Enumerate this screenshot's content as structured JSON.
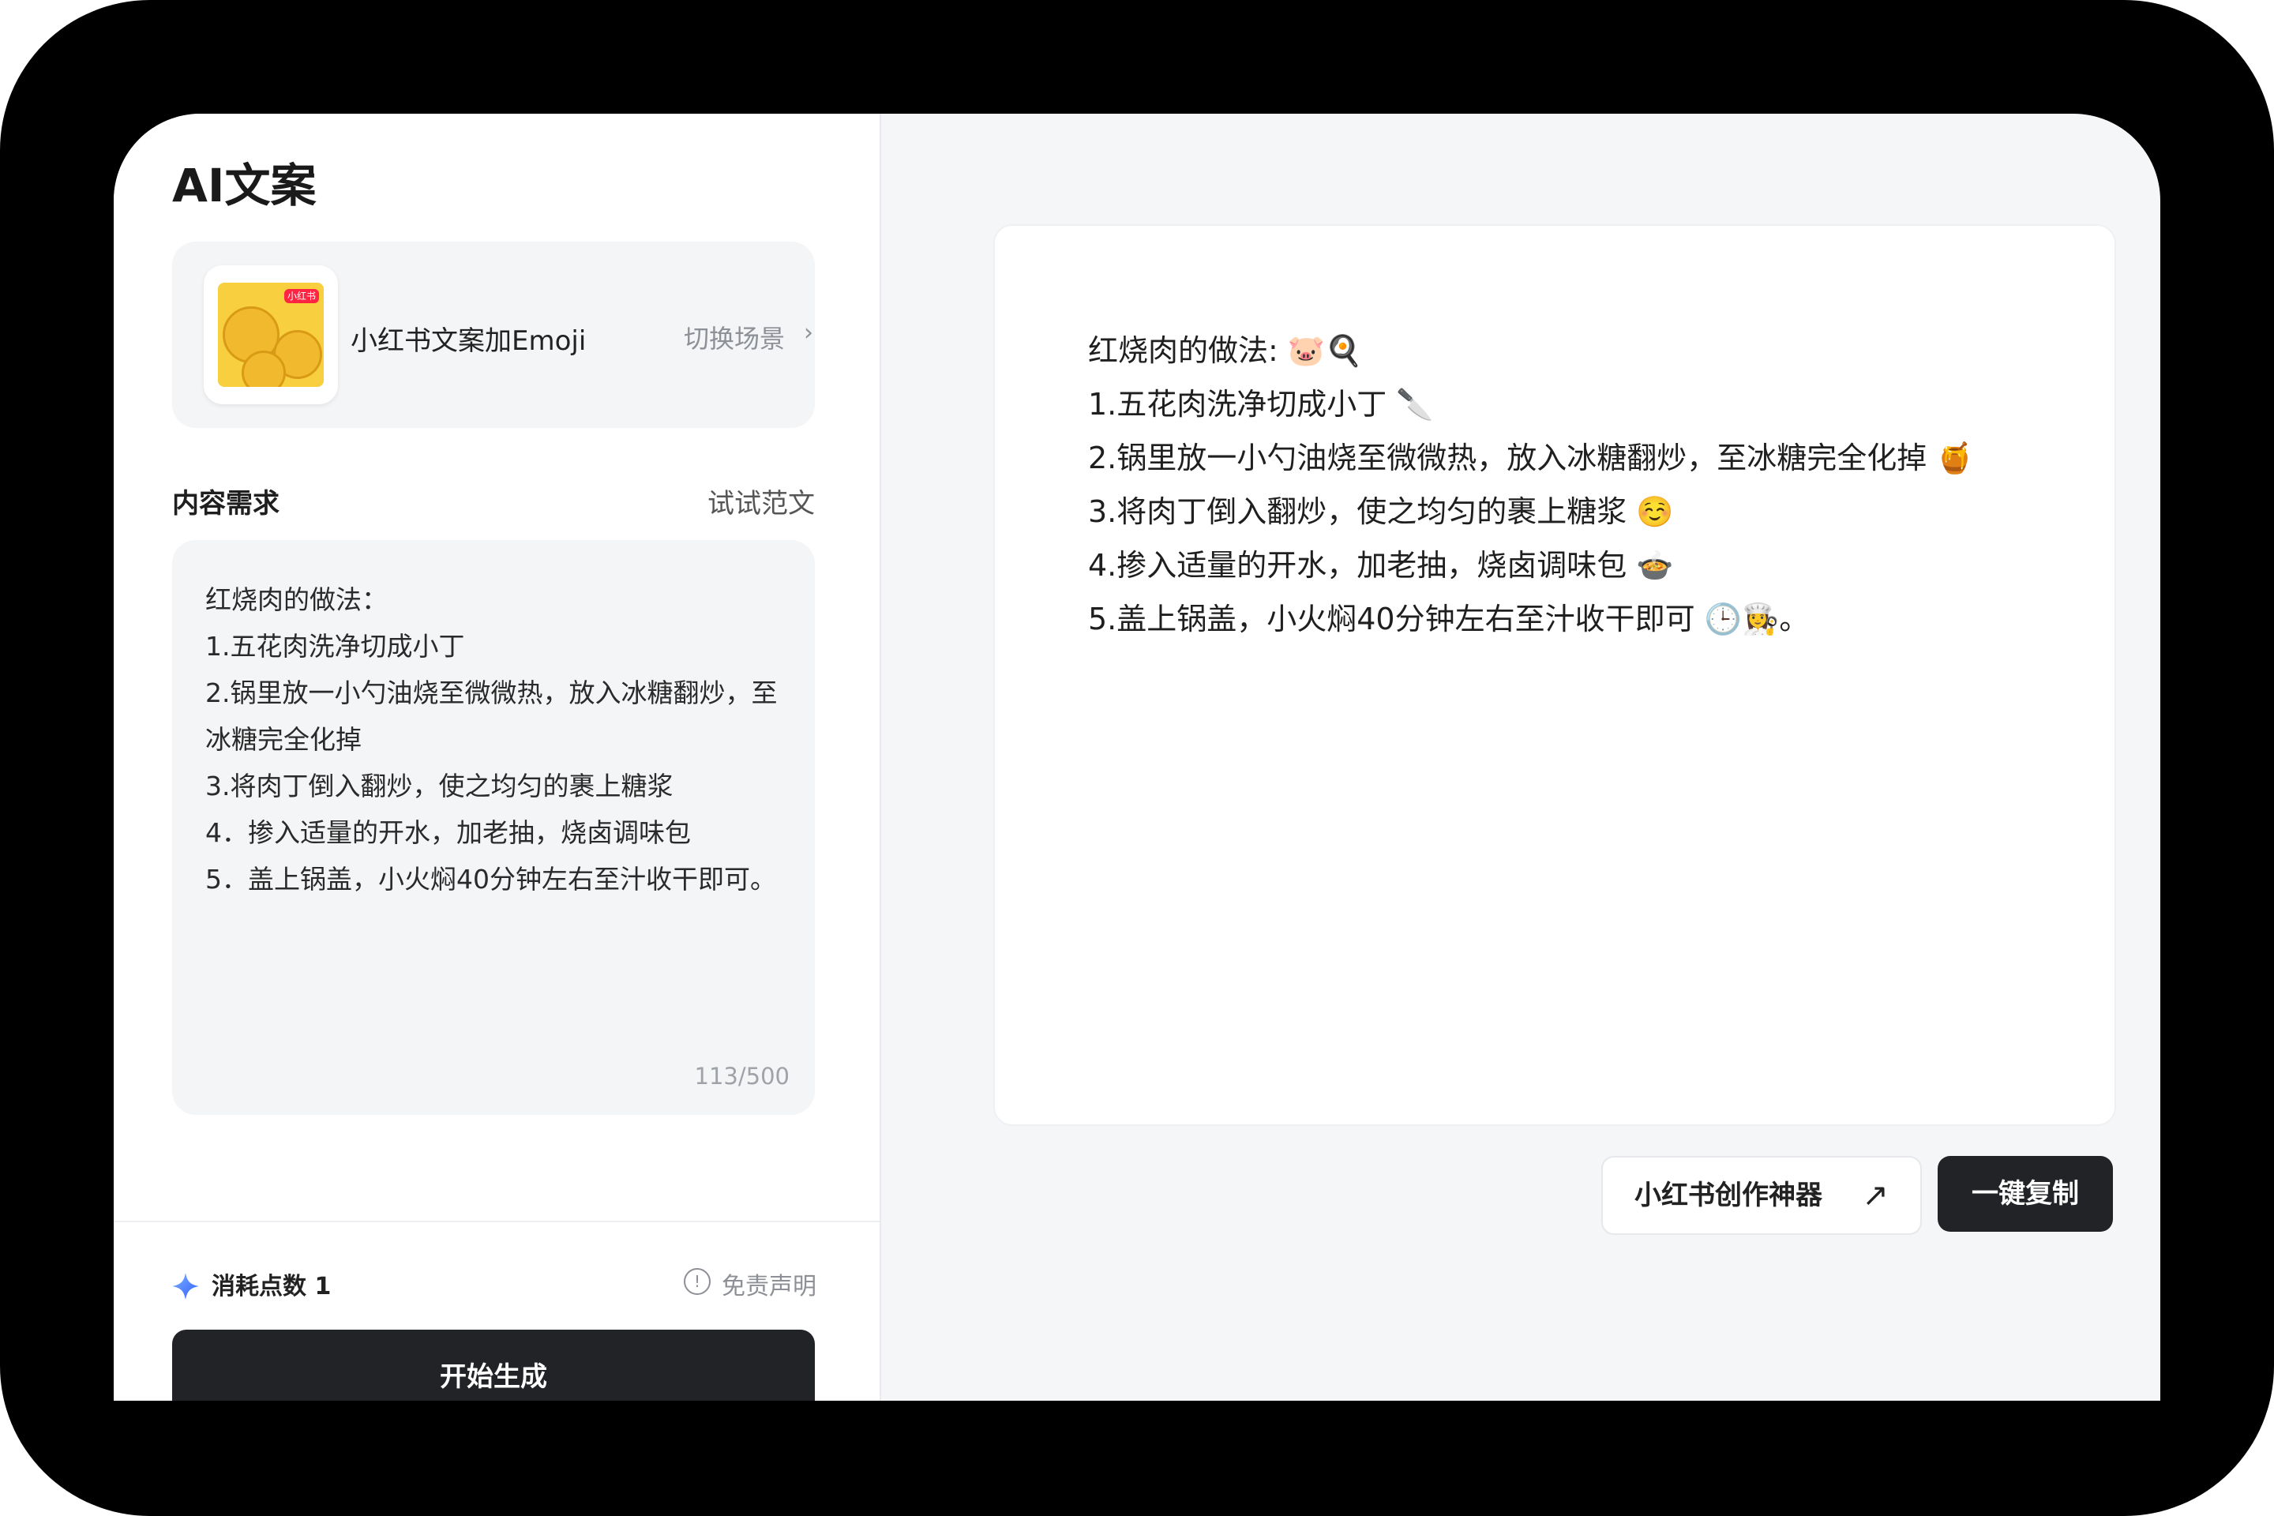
{
  "app": {
    "title": "AI文案"
  },
  "scene": {
    "badge": "小红书",
    "name": "小红书文案加Emoji",
    "switch_label": "切换场景",
    "chevron": "›"
  },
  "requirement": {
    "label": "内容需求",
    "sample_link": "试试范文",
    "text": "红烧肉的做法：\n1.五花肉洗净切成小丁\n2.锅里放一小勺油烧至微微热，放入冰糖翻炒，至冰糖完全化掉\n3.将肉丁倒入翻炒，使之均匀的裹上糖浆\n4．掺入适量的开水，加老抽，烧卤调味包\n5．盖上锅盖，小火焖40分钟左右至汁收干即可。",
    "count": "113/500"
  },
  "footer": {
    "cost_label": "消耗点数 1",
    "disclaimer": "免责声明",
    "disclaimer_icon": "!",
    "generate_button": "开始生成"
  },
  "result": {
    "text": "红烧肉的做法: 🐷🍳\n1.五花肉洗净切成小丁 🔪\n2.锅里放一小勺油烧至微微热，放入冰糖翻炒，至冰糖完全化掉 🍯\n3.将肉丁倒入翻炒，使之均匀的裹上糖浆 ☺️\n4.掺入适量的开水，加老抽，烧卤调味包 🍲\n5.盖上锅盖，小火焖40分钟左右至汁收干即可 🕒👩‍🍳。"
  },
  "actions": {
    "creator_button": "小红书创作神器",
    "creator_arrow": "↗",
    "copy_button": "一键复制"
  },
  "icons": {
    "spark": "sparkle-icon",
    "disclaimer": "info-circle-icon",
    "external": "external-arrow-icon",
    "chevron": "chevron-right-icon"
  },
  "colors": {
    "primary_dark": "#222326",
    "panel_bg": "#f5f6f8",
    "card_bg": "#f4f5f7",
    "spark_blue": "#3a7bff",
    "badge_red": "#ff2442"
  }
}
